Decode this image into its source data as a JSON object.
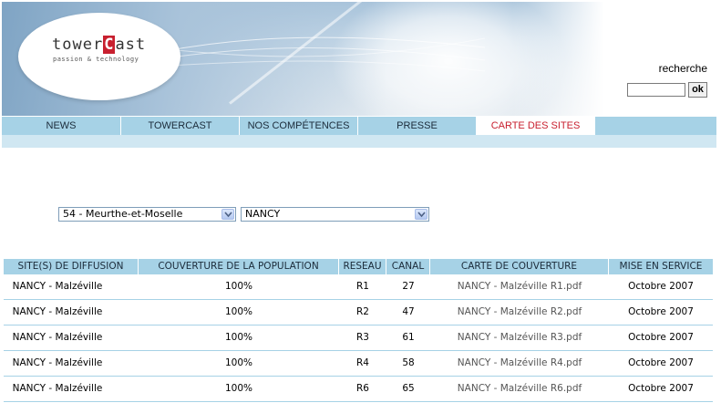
{
  "header": {
    "logo_pre": "tower",
    "logo_c": "C",
    "logo_post": "ast",
    "tagline": "passion & technology",
    "search_label": "recherche",
    "search_value": "",
    "search_button": "ok"
  },
  "nav": {
    "items": [
      {
        "label": "NEWS"
      },
      {
        "label": "TOWERCAST"
      },
      {
        "label": "NOS COMPÉTENCES"
      },
      {
        "label": "PRESSE"
      },
      {
        "label": "CARTE DES SITES"
      }
    ],
    "active_index": 4
  },
  "filters": {
    "department": "54 - Meurthe-et-Moselle",
    "city": "NANCY"
  },
  "table": {
    "headers": [
      "SITE(S) DE DIFFUSION",
      "COUVERTURE DE LA POPULATION",
      "RESEAU",
      "CANAL",
      "CARTE DE COUVERTURE",
      "MISE EN SERVICE"
    ],
    "rows": [
      [
        "NANCY - Malzéville",
        "100%",
        "R1",
        "27",
        "NANCY - Malzéville R1.pdf",
        "Octobre 2007"
      ],
      [
        "NANCY - Malzéville",
        "100%",
        "R2",
        "47",
        "NANCY - Malzéville R2.pdf",
        "Octobre 2007"
      ],
      [
        "NANCY - Malzéville",
        "100%",
        "R3",
        "61",
        "NANCY - Malzéville R3.pdf",
        "Octobre 2007"
      ],
      [
        "NANCY - Malzéville",
        "100%",
        "R4",
        "58",
        "NANCY - Malzéville R4.pdf",
        "Octobre 2007"
      ],
      [
        "NANCY - Malzéville",
        "100%",
        "R6",
        "65",
        "NANCY - Malzéville R6.pdf",
        "Octobre 2007"
      ]
    ]
  },
  "colors": {
    "accent": "#c8202f",
    "nav_bg": "#a6d2e6",
    "subbar_bg": "#d0e7f2"
  }
}
